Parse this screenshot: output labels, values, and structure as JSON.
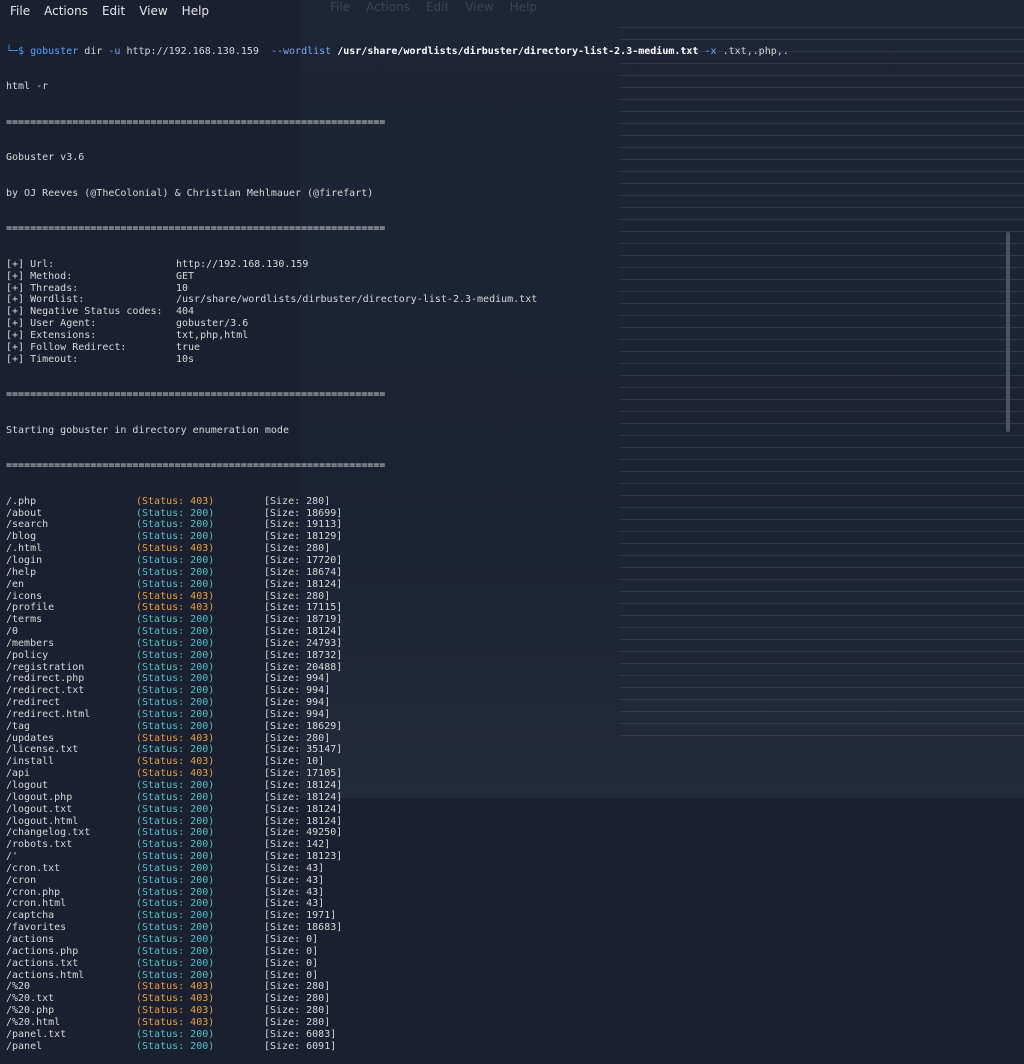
{
  "menu": [
    "File",
    "Actions",
    "Edit",
    "View",
    "Help"
  ],
  "bg_menu": [
    "File",
    "Actions",
    "Edit",
    "View",
    "Help"
  ],
  "command": {
    "prompt": "└─$",
    "program": "gobuster",
    "sub": "dir",
    "url_flag": "-u",
    "url": "http://192.168.130.159",
    "wordlist_flag": "--wordlist",
    "wordlist": "/usr/share/wordlists/dirbuster/directory-list-2.3-medium.txt",
    "ext_flag": "-x",
    "ext": ".txt,.php,.",
    "wrap": "html -r"
  },
  "separator": "===============================================================",
  "banner": {
    "version": "Gobuster v3.6",
    "authors": "by OJ Reeves (@TheColonial) & Christian Mehlmauer (@firefart)"
  },
  "config": [
    {
      "k": "[+] Url:",
      "v": "http://192.168.130.159"
    },
    {
      "k": "[+] Method:",
      "v": "GET"
    },
    {
      "k": "[+] Threads:",
      "v": "10"
    },
    {
      "k": "[+] Wordlist:",
      "v": "/usr/share/wordlists/dirbuster/directory-list-2.3-medium.txt"
    },
    {
      "k": "[+] Negative Status codes:",
      "v": "404"
    },
    {
      "k": "[+] User Agent:",
      "v": "gobuster/3.6"
    },
    {
      "k": "[+] Extensions:",
      "v": "txt,php,html"
    },
    {
      "k": "[+] Follow Redirect:",
      "v": "true"
    },
    {
      "k": "[+] Timeout:",
      "v": "10s"
    }
  ],
  "starting": "Starting gobuster in directory enumeration mode",
  "colors": {
    "status403": "#e8a040",
    "status200": "#56c0c8"
  },
  "results": [
    {
      "path": "/.php",
      "status": "403",
      "size": "280"
    },
    {
      "path": "/about",
      "status": "200",
      "size": "18699"
    },
    {
      "path": "/search",
      "status": "200",
      "size": "19113"
    },
    {
      "path": "/blog",
      "status": "200",
      "size": "18129"
    },
    {
      "path": "/.html",
      "status": "403",
      "size": "280"
    },
    {
      "path": "/login",
      "status": "200",
      "size": "17720"
    },
    {
      "path": "/help",
      "status": "200",
      "size": "18674"
    },
    {
      "path": "/en",
      "status": "200",
      "size": "18124"
    },
    {
      "path": "/icons",
      "status": "403",
      "size": "280"
    },
    {
      "path": "/profile",
      "status": "403",
      "size": "17115"
    },
    {
      "path": "/terms",
      "status": "200",
      "size": "18719"
    },
    {
      "path": "/0",
      "status": "200",
      "size": "18124"
    },
    {
      "path": "/members",
      "status": "200",
      "size": "24793"
    },
    {
      "path": "/policy",
      "status": "200",
      "size": "18732"
    },
    {
      "path": "/registration",
      "status": "200",
      "size": "20488"
    },
    {
      "path": "/redirect.php",
      "status": "200",
      "size": "994"
    },
    {
      "path": "/redirect.txt",
      "status": "200",
      "size": "994"
    },
    {
      "path": "/redirect",
      "status": "200",
      "size": "994"
    },
    {
      "path": "/redirect.html",
      "status": "200",
      "size": "994"
    },
    {
      "path": "/tag",
      "status": "200",
      "size": "18629"
    },
    {
      "path": "/updates",
      "status": "403",
      "size": "280"
    },
    {
      "path": "/license.txt",
      "status": "200",
      "size": "35147"
    },
    {
      "path": "/install",
      "status": "403",
      "size": "10"
    },
    {
      "path": "/api",
      "status": "403",
      "size": "17105"
    },
    {
      "path": "/logout",
      "status": "200",
      "size": "18124"
    },
    {
      "path": "/logout.php",
      "status": "200",
      "size": "18124"
    },
    {
      "path": "/logout.txt",
      "status": "200",
      "size": "18124"
    },
    {
      "path": "/logout.html",
      "status": "200",
      "size": "18124"
    },
    {
      "path": "/changelog.txt",
      "status": "200",
      "size": "49250"
    },
    {
      "path": "/robots.txt",
      "status": "200",
      "size": "142"
    },
    {
      "path": "/'",
      "status": "200",
      "size": "18123"
    },
    {
      "path": "/cron.txt",
      "status": "200",
      "size": "43"
    },
    {
      "path": "/cron",
      "status": "200",
      "size": "43"
    },
    {
      "path": "/cron.php",
      "status": "200",
      "size": "43"
    },
    {
      "path": "/cron.html",
      "status": "200",
      "size": "43"
    },
    {
      "path": "/captcha",
      "status": "200",
      "size": "1971"
    },
    {
      "path": "/favorites",
      "status": "200",
      "size": "18683"
    },
    {
      "path": "/actions",
      "status": "200",
      "size": "0"
    },
    {
      "path": "/actions.php",
      "status": "200",
      "size": "0"
    },
    {
      "path": "/actions.txt",
      "status": "200",
      "size": "0"
    },
    {
      "path": "/actions.html",
      "status": "200",
      "size": "0"
    },
    {
      "path": "/%20",
      "status": "403",
      "size": "280"
    },
    {
      "path": "/%20.txt",
      "status": "403",
      "size": "280"
    },
    {
      "path": "/%20.php",
      "status": "403",
      "size": "280"
    },
    {
      "path": "/%20.html",
      "status": "403",
      "size": "280"
    },
    {
      "path": "/panel.txt",
      "status": "200",
      "size": "6083"
    },
    {
      "path": "/panel",
      "status": "200",
      "size": "6091"
    }
  ]
}
